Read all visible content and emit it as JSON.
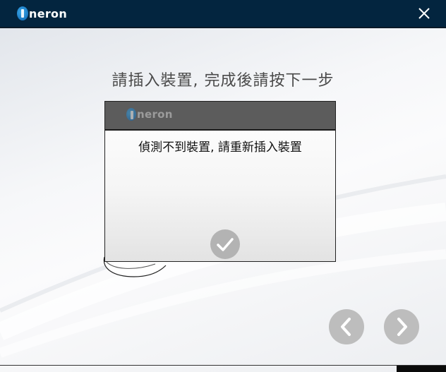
{
  "app": {
    "logo_text": "neron",
    "close_icon": "close-icon"
  },
  "instruction": "請插入裝置, 完成後請按下一步",
  "dialog": {
    "logo_text": "neron",
    "message": "偵測不到裝置, 請重新插入裝置",
    "confirm_icon": "checkmark-icon"
  },
  "navigation": {
    "prev_icon": "chevron-left-icon",
    "next_icon": "chevron-right-icon"
  },
  "colors": {
    "titlebar": "#03253f",
    "brand_blue": "#1a78c2",
    "dialog_header": "#5c5c5c",
    "button_gray": "#bdbdbd"
  }
}
